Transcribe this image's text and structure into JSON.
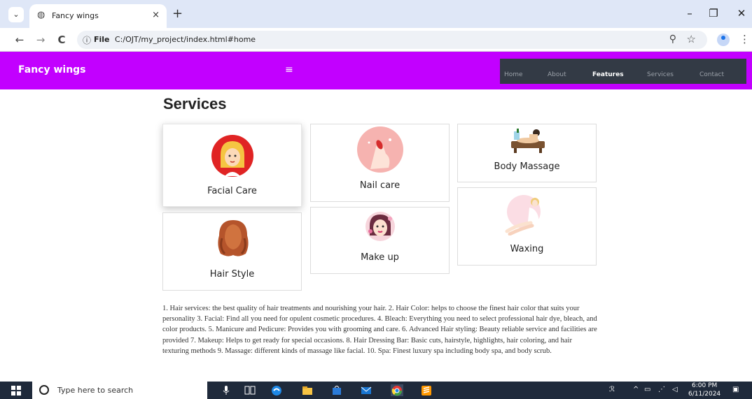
{
  "browser": {
    "tab_title": "Fancy wings",
    "tab_close": "×",
    "new_tab": "+",
    "file_label": "File",
    "url": "C:/OJT/my_project/index.html#home",
    "window_controls": {
      "minimize": "–",
      "restore": "❐",
      "close": "✕"
    },
    "nav_icons": {
      "back": "←",
      "forward": "→",
      "reload": "C"
    },
    "icons": [
      "tab-search-icon",
      "globe-icon",
      "info-icon",
      "zoom-icon",
      "star-icon",
      "profile-icon",
      "more-icon"
    ]
  },
  "site": {
    "brand": "Fancy wings",
    "hamburger": "≡",
    "nav_items": [
      "Home",
      "About",
      "Features",
      "Services",
      "Contact"
    ],
    "active_nav": "Features",
    "brand_color": "#c200ff",
    "menu_bg": "#333a45"
  },
  "services": {
    "title": "Services",
    "cards": [
      {
        "label": "Facial Care",
        "icon": "facial-care-illustration"
      },
      {
        "label": "Nail care",
        "icon": "nail-care-illustration"
      },
      {
        "label": "Body Massage",
        "icon": "body-massage-illustration"
      },
      {
        "label": "Hair Style",
        "icon": "hair-style-illustration"
      },
      {
        "label": "Make up",
        "icon": "make-up-illustration"
      },
      {
        "label": "Waxing",
        "icon": "waxing-illustration"
      }
    ],
    "description": "1. Hair services: the best quality of hair treatments and nourishing your hair. 2. Hair Color: helps to choose the finest hair color that suits your personality 3. Facial: Find all you need for opulent cosmetic procedures. 4. Bleach: Everything you need to select professional hair dye, bleach, and color products. 5. Manicure and Pedicure: Provides you with grooming and care. 6. Advanced Hair styling: Beauty reliable service and facilities are provided 7. Makeup: Helps to get ready for special occasions. 8. Hair Dressing Bar: Basic cuts, hairstyle, highlights, hair coloring, and hair texturing methods 9. Massage: different kinds of massage like facial. 10. Spa: Finest luxury spa including body spa, and body scrub."
  },
  "taskbar": {
    "search_placeholder": "Type here to search",
    "time": "6:00 PM",
    "date": "6/11/2024",
    "icons": [
      "windows-start-icon",
      "search-icon",
      "microphone-icon",
      "task-view-icon",
      "edge-icon",
      "file-explorer-icon",
      "store-icon",
      "mail-icon",
      "chrome-icon",
      "sublime-icon",
      "people-icon",
      "chevron-up-icon",
      "network-icon",
      "wifi-icon",
      "volume-icon",
      "notification-icon"
    ]
  }
}
